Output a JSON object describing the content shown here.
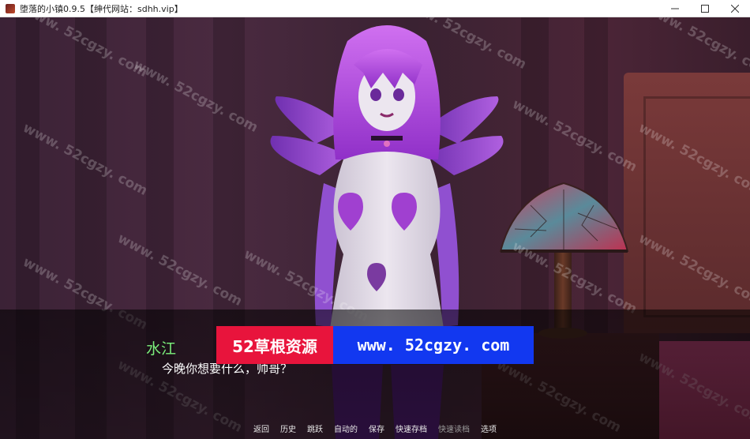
{
  "window": {
    "title": "堕落的小镇0.9.5【绅代网站：sdhh.vip】",
    "icon": "game-app-icon",
    "controls": [
      "minimize-icon",
      "maximize-icon",
      "close-icon"
    ]
  },
  "dialogue": {
    "speaker": "水江",
    "text": "今晚你想要什么，帅哥？"
  },
  "banners": {
    "left_text": "52草根资源",
    "right_text": "www. 52cgzy. com",
    "left_color": "#e8143c",
    "right_color": "#1238f0"
  },
  "watermark": "www. 52cgzy. com",
  "quick_menu": [
    {
      "label": "返回",
      "enabled": true
    },
    {
      "label": "历史",
      "enabled": true
    },
    {
      "label": "跳跃",
      "enabled": true
    },
    {
      "label": "自动的",
      "enabled": true
    },
    {
      "label": "保存",
      "enabled": true
    },
    {
      "label": "快速存档",
      "enabled": true
    },
    {
      "label": "快速读档",
      "enabled": false
    },
    {
      "label": "选项",
      "enabled": true
    }
  ],
  "colors": {
    "speaker_name": "#7cf07c",
    "dialogue_text": "#ffffff",
    "character_hair": "#b04ce8",
    "character_skin": "#e8e2ea"
  }
}
